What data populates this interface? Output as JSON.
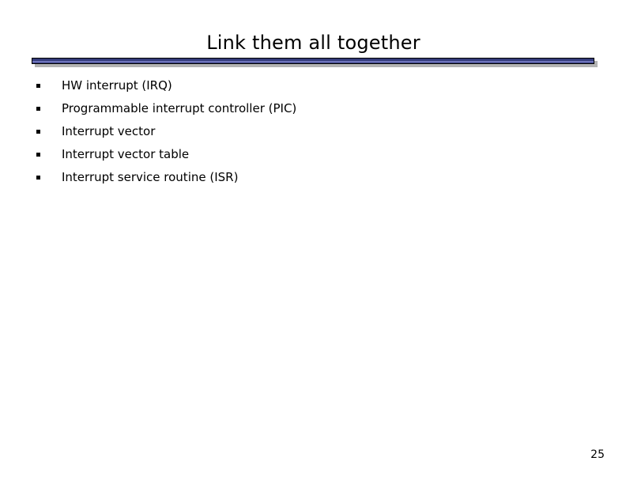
{
  "slide": {
    "title": "Link them all together",
    "page_number": "25",
    "accent_color": "#333a7a",
    "accent_highlight_color": "#6d73bb",
    "shadow_color": "#b3b3b3",
    "background_color": "#ffffff",
    "text_color": "#000000",
    "bullet_marker_glyph": "§",
    "bullets": [
      {
        "text": "HW interrupt (IRQ)"
      },
      {
        "text": "Programmable interrupt controller (PIC)"
      },
      {
        "text": "Interrupt vector"
      },
      {
        "text": "Interrupt vector table"
      },
      {
        "text": "Interrupt service routine (ISR)"
      }
    ]
  }
}
